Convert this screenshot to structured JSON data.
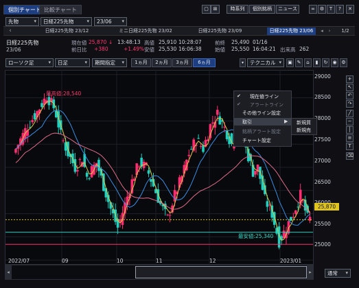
{
  "tabs": [
    {
      "label": "個別チャート",
      "active": true
    },
    {
      "label": "比較チャート",
      "active": false
    }
  ],
  "toolbar": {
    "timeseries": "時系列",
    "stock_list": "個別銘柄",
    "news": "ニュース",
    "page": "1/2"
  },
  "controls": {
    "market": "先物",
    "instrument": "日経225先物",
    "contract": "23/06"
  },
  "instrument_tabs": [
    "日経225先物 23/12",
    "ミニ日経225先物 23/02",
    "日経225先物 23/09",
    "日経225先物 23/06"
  ],
  "quote": {
    "name": "日経225先物",
    "code": "23/06",
    "current_label": "現在値",
    "current_value": "25,870",
    "current_arrow": "↓",
    "current_time": "13:48:13",
    "high_label": "高値",
    "high_value": "25,910",
    "high_time": "10:28:07",
    "prev_close_label": "前終",
    "prev_close_value": "25,490",
    "prev_close_date": "01/16",
    "change_label": "前日比",
    "change_value": "+380",
    "change_pct": "+1.49%",
    "low_label": "安値",
    "low_value": "25,530",
    "low_time": "16:06:38",
    "open_label": "始値",
    "open_value": "25,550",
    "open_time": "16:04:21",
    "volume_label": "出来高",
    "volume_value": "262"
  },
  "chart_controls": {
    "candle_type": "ローソク足",
    "period": "日足",
    "range_label": "期間指定",
    "periods": [
      "1ヵ月",
      "2ヵ月",
      "3ヵ月",
      "6ヵ月"
    ],
    "technical": "テクニカル"
  },
  "context_menu": {
    "items": [
      {
        "label": "現在値ライン",
        "checked": true,
        "enabled": true
      },
      {
        "label": "アラートライン",
        "checked": true,
        "enabled": false
      },
      {
        "label": "その他ライン設定",
        "checked": false,
        "enabled": true
      },
      {
        "label": "取引",
        "checked": false,
        "enabled": true,
        "submenu": true
      },
      {
        "label": "銘柄アラート設定",
        "checked": false,
        "enabled": false
      },
      {
        "label": "チャート設定",
        "checked": false,
        "enabled": true
      }
    ],
    "submenu": [
      "新規買",
      "新規売"
    ]
  },
  "chart": {
    "high_label": "最高値:28,540",
    "low_label": "最安値:25,340",
    "current_price_badge": "25,870",
    "bottom_select": "通常"
  },
  "chart_data": {
    "type": "candlestick",
    "x_labels": [
      "2022/07",
      "09",
      "10",
      "11",
      "12",
      "2023/01"
    ],
    "y_ticks": [
      "29000",
      "28500",
      "28000",
      "27500",
      "27000",
      "26500",
      "26000",
      "25500",
      "25000"
    ],
    "ylim": [
      24900,
      29100
    ],
    "max": 28540,
    "min": 25340,
    "current": 25870,
    "series": [
      {
        "name": "ma_short",
        "color": "#d9c94a"
      },
      {
        "name": "ma_mid",
        "color": "#3a8ee6"
      },
      {
        "name": "ma_long",
        "color": "#e06c8a"
      }
    ]
  }
}
